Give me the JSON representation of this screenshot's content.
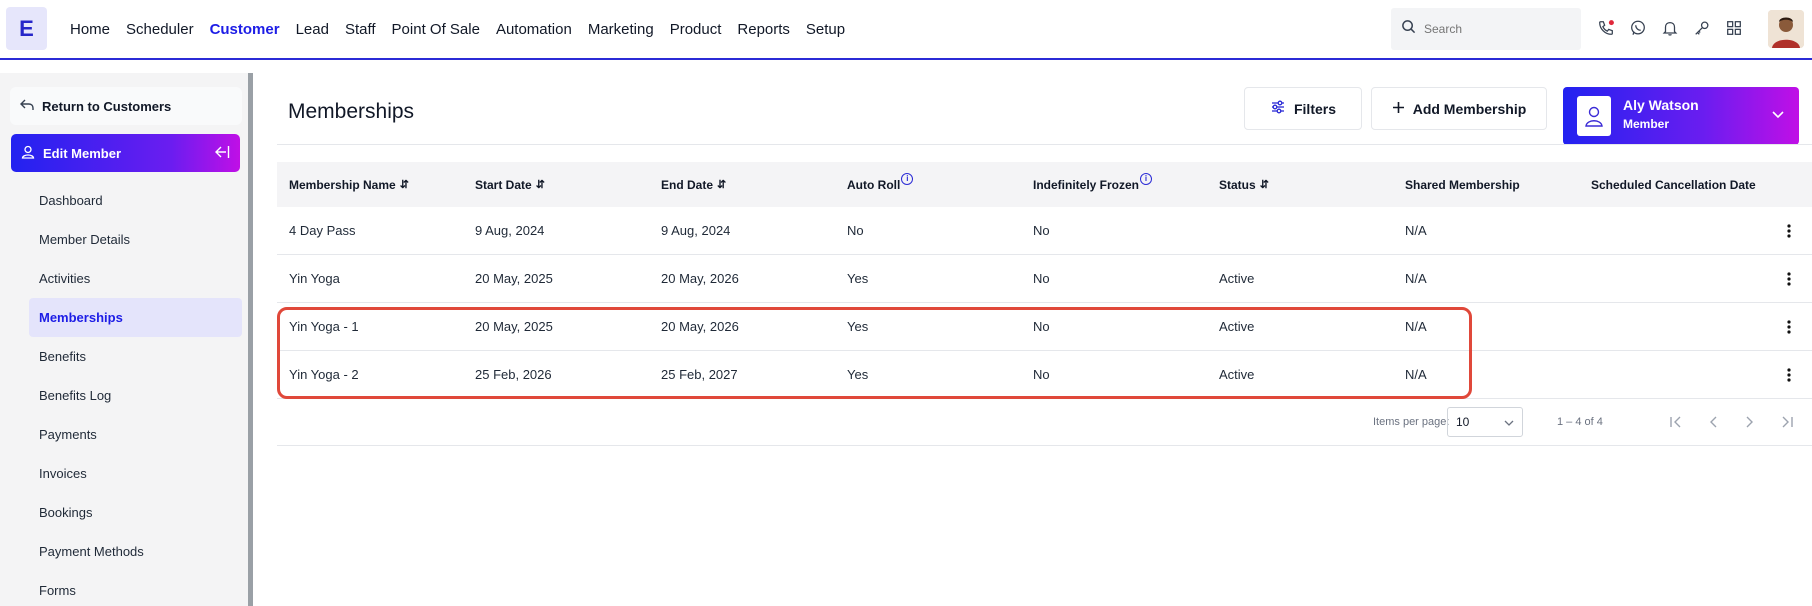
{
  "app": {
    "logo_letter": "E",
    "accent_color": "#1d1de6"
  },
  "nav": {
    "items": [
      {
        "label": "Home",
        "active": false
      },
      {
        "label": "Scheduler",
        "active": false
      },
      {
        "label": "Customer",
        "active": true
      },
      {
        "label": "Lead",
        "active": false
      },
      {
        "label": "Staff",
        "active": false
      },
      {
        "label": "Point Of Sale",
        "active": false
      },
      {
        "label": "Automation",
        "active": false
      },
      {
        "label": "Marketing",
        "active": false
      },
      {
        "label": "Product",
        "active": false
      },
      {
        "label": "Reports",
        "active": false
      },
      {
        "label": "Setup",
        "active": false
      }
    ],
    "search_placeholder": "Search",
    "icons": [
      "phone-icon",
      "whatsapp-icon",
      "bell-icon",
      "key-icon",
      "grid-icon"
    ]
  },
  "sidebar": {
    "return_label": "Return to Customers",
    "section_label": "Edit Member",
    "items": [
      {
        "label": "Dashboard",
        "active": false
      },
      {
        "label": "Member Details",
        "active": false
      },
      {
        "label": "Activities",
        "active": false
      },
      {
        "label": "Memberships",
        "active": true
      },
      {
        "label": "Benefits",
        "active": false
      },
      {
        "label": "Benefits Log",
        "active": false
      },
      {
        "label": "Payments",
        "active": false
      },
      {
        "label": "Invoices",
        "active": false
      },
      {
        "label": "Bookings",
        "active": false
      },
      {
        "label": "Payment Methods",
        "active": false
      },
      {
        "label": "Forms",
        "active": false
      }
    ]
  },
  "main": {
    "title": "Memberships",
    "filters_label": "Filters",
    "add_label": "Add Membership",
    "member": {
      "name": "Aly Watson",
      "role": "Member"
    }
  },
  "table": {
    "columns": [
      {
        "label": "Membership Name",
        "sortable": true,
        "info": false
      },
      {
        "label": "Start Date",
        "sortable": true,
        "info": false
      },
      {
        "label": "End Date",
        "sortable": true,
        "info": false
      },
      {
        "label": "Auto Roll",
        "sortable": false,
        "info": true
      },
      {
        "label": "Indefinitely Frozen",
        "sortable": false,
        "info": true
      },
      {
        "label": "Status",
        "sortable": true,
        "info": false
      },
      {
        "label": "Shared Membership",
        "sortable": false,
        "info": false
      },
      {
        "label": "Scheduled Cancellation Date",
        "sortable": false,
        "info": false
      }
    ],
    "rows": [
      [
        "4 Day Pass",
        "9 Aug, 2024",
        "9 Aug, 2024",
        "No",
        "No",
        "",
        "N/A",
        ""
      ],
      [
        "Yin Yoga",
        "20 May, 2025",
        "20 May, 2026",
        "Yes",
        "No",
        "Active",
        "N/A",
        ""
      ],
      [
        "Yin Yoga - 1",
        "20 May, 2025",
        "20 May, 2026",
        "Yes",
        "No",
        "Active",
        "N/A",
        ""
      ],
      [
        "Yin Yoga - 2",
        "25 Feb, 2026",
        "25 Feb, 2027",
        "Yes",
        "No",
        "Active",
        "N/A",
        ""
      ]
    ],
    "highlight_color": "#e0483a"
  },
  "pagination": {
    "items_per_page_label": "Items per page:",
    "items_per_page_value": "10",
    "range_label": "1 – 4 of 4"
  }
}
